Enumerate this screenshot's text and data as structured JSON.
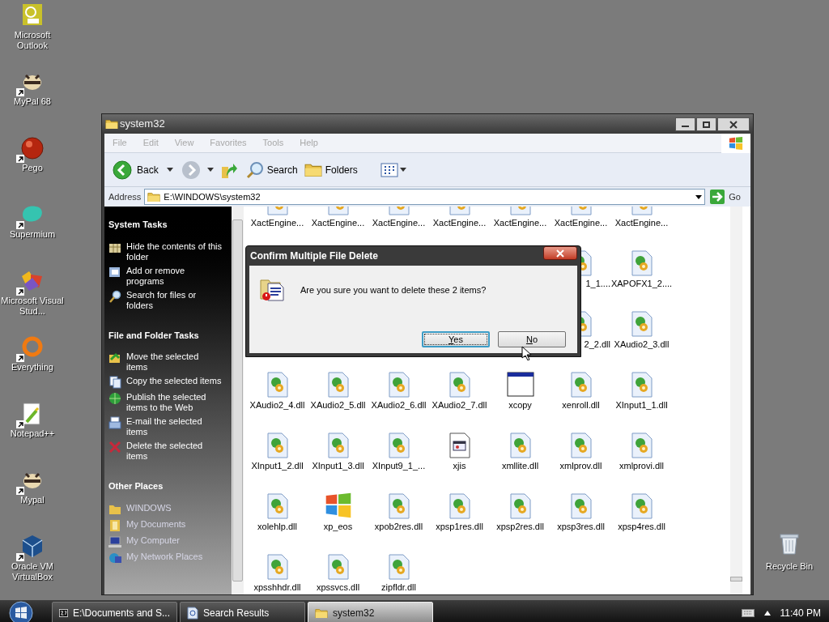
{
  "desktop_icons": [
    {
      "label": "Microsoft Outlook",
      "kind": "outlook",
      "shortcut": false
    },
    {
      "label": "MyPal 68",
      "kind": "raccoon",
      "shortcut": true
    },
    {
      "label": "Pego",
      "kind": "ball",
      "shortcut": true
    },
    {
      "label": "Supermium",
      "kind": "blob",
      "shortcut": true
    },
    {
      "label": "Microsoft Visual Stud...",
      "kind": "studio",
      "shortcut": true
    },
    {
      "label": "Everything",
      "kind": "ring",
      "shortcut": true
    },
    {
      "label": "Notepad++",
      "kind": "notepad",
      "shortcut": true
    },
    {
      "label": "Mypal",
      "kind": "raccoon",
      "shortcut": true
    },
    {
      "label": "Oracle VM VirtualBox",
      "kind": "cube",
      "shortcut": true
    }
  ],
  "recycle_bin": {
    "label": "Recycle Bin"
  },
  "window": {
    "title": "system32",
    "menu": [
      {
        "label": "File",
        "disabled": true
      },
      {
        "label": "Edit",
        "disabled": true
      },
      {
        "label": "View",
        "disabled": true
      },
      {
        "label": "Favorites",
        "disabled": true
      },
      {
        "label": "Tools",
        "disabled": true
      },
      {
        "label": "Help",
        "disabled": true
      }
    ],
    "toolbar": {
      "back": "Back",
      "search": "Search",
      "folders": "Folders"
    },
    "address": {
      "label": "Address",
      "value": "E:\\WINDOWS\\system32",
      "go": "Go"
    },
    "task_pane": [
      {
        "title": "System Tasks",
        "items": [
          {
            "label": "Hide the contents of this folder",
            "kind": "grid"
          },
          {
            "label": "Add or remove programs",
            "kind": "install"
          },
          {
            "label": "Search for files or folders",
            "kind": "magnifier"
          }
        ]
      },
      {
        "title": "File and Folder Tasks",
        "items": [
          {
            "label": "Move the selected items",
            "kind": "move"
          },
          {
            "label": "Copy the selected items",
            "kind": "copy"
          },
          {
            "label": "Publish the selected items to the Web",
            "kind": "globe"
          },
          {
            "label": "E-mail the selected items",
            "kind": "mail"
          },
          {
            "label": "Delete the selected items",
            "kind": "cross"
          }
        ]
      },
      {
        "title": "Other Places",
        "items": [
          {
            "label": "WINDOWS",
            "kind": "folder"
          },
          {
            "label": "My Documents",
            "kind": "docs"
          },
          {
            "label": "My Computer",
            "kind": "computer"
          },
          {
            "label": "My Network Places",
            "kind": "network"
          }
        ]
      }
    ],
    "files": [
      [
        {
          "label": "XactEngine...",
          "kind": "dll"
        },
        {
          "label": "XactEngine...",
          "kind": "dll"
        },
        {
          "label": "XactEngine...",
          "kind": "dll"
        },
        {
          "label": "XactEngine...",
          "kind": "dll"
        },
        {
          "label": "XactEngine...",
          "kind": "dll"
        },
        {
          "label": "XactEngine...",
          "kind": "dll"
        },
        {
          "label": "XactEngine...",
          "kind": "dll"
        }
      ],
      [
        {
          "kind": "covered"
        },
        {
          "kind": "covered"
        },
        {
          "kind": "covered"
        },
        {
          "kind": "covered"
        },
        {
          "kind": "covered"
        },
        {
          "label": "1_1....",
          "kind": "dll",
          "clipped": true
        },
        {
          "label": "XAPOFX1_2....",
          "kind": "dll"
        }
      ],
      [
        {
          "kind": "covered"
        },
        {
          "kind": "covered"
        },
        {
          "kind": "covered"
        },
        {
          "kind": "covered"
        },
        {
          "kind": "covered"
        },
        {
          "label": "2_2.dll",
          "kind": "dll",
          "clipped": true
        },
        {
          "label": "XAudio2_3.dll",
          "kind": "dll"
        }
      ],
      [
        {
          "label": "XAudio2_4.dll",
          "kind": "dll"
        },
        {
          "label": "XAudio2_5.dll",
          "kind": "dll"
        },
        {
          "label": "XAudio2_6.dll",
          "kind": "dll"
        },
        {
          "label": "XAudio2_7.dll",
          "kind": "dll"
        },
        {
          "label": "xcopy",
          "kind": "window"
        },
        {
          "label": "xenroll.dll",
          "kind": "dll"
        },
        {
          "label": "XInput1_1.dll",
          "kind": "dll"
        }
      ],
      [
        {
          "label": "XInput1_2.dll",
          "kind": "dll"
        },
        {
          "label": "XInput1_3.dll",
          "kind": "dll"
        },
        {
          "label": "XInput9_1_...",
          "kind": "dll"
        },
        {
          "label": "xjis",
          "kind": "doc"
        },
        {
          "label": "xmllite.dll",
          "kind": "dll"
        },
        {
          "label": "xmlprov.dll",
          "kind": "dll"
        },
        {
          "label": "xmlprovi.dll",
          "kind": "dll"
        }
      ],
      [
        {
          "label": "xolehlp.dll",
          "kind": "dll"
        },
        {
          "label": "xp_eos",
          "kind": "flag"
        },
        {
          "label": "xpob2res.dll",
          "kind": "dll"
        },
        {
          "label": "xpsp1res.dll",
          "kind": "dll"
        },
        {
          "label": "xpsp2res.dll",
          "kind": "dll"
        },
        {
          "label": "xpsp3res.dll",
          "kind": "dll"
        },
        {
          "label": "xpsp4res.dll",
          "kind": "dll"
        }
      ],
      [
        {
          "label": "xpsshhdr.dll",
          "kind": "dll"
        },
        {
          "label": "xpssvcs.dll",
          "kind": "dll"
        },
        {
          "label": "zipfldr.dll",
          "kind": "dll"
        }
      ]
    ]
  },
  "dialog": {
    "title": "Confirm Multiple File Delete",
    "message": "Are you sure you want to delete these 2 items?",
    "buttons": [
      {
        "label": "Yes",
        "focused": true
      },
      {
        "label": "No",
        "focused": false
      }
    ]
  },
  "taskbar": {
    "buttons": [
      {
        "label": "E:\\Documents and S...",
        "kind": "archive",
        "selected": false
      },
      {
        "label": "Search Results",
        "kind": "search",
        "selected": false
      },
      {
        "label": "system32",
        "kind": "folder",
        "selected": true
      }
    ],
    "clock": "11:40 PM"
  }
}
